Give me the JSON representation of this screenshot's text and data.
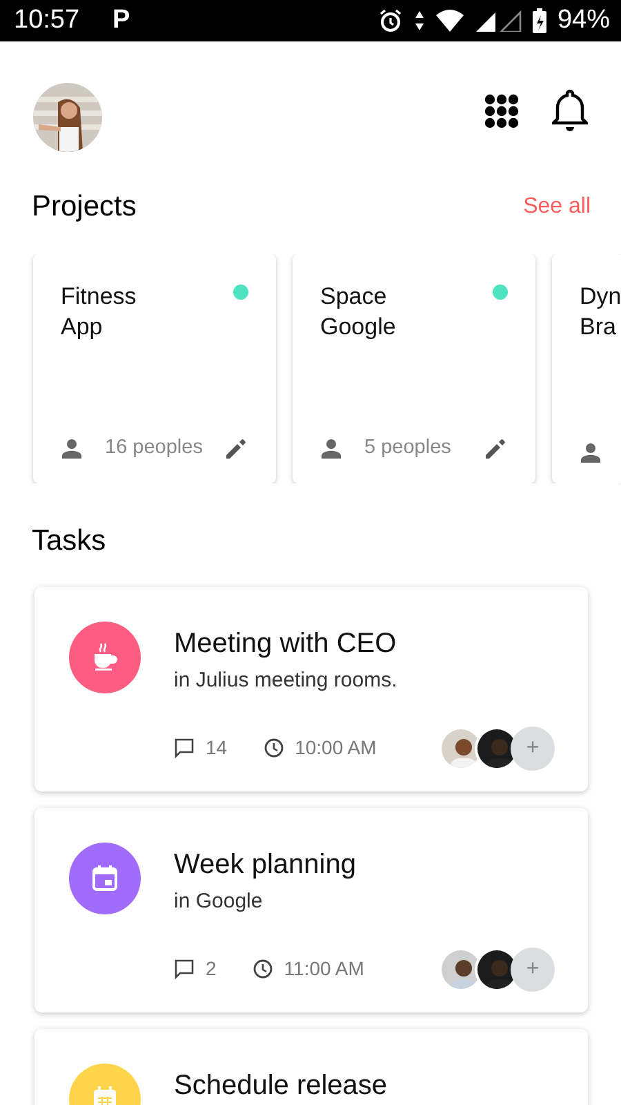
{
  "status_bar": {
    "time": "10:57",
    "notification": "P",
    "battery": "94%"
  },
  "projects": {
    "title": "Projects",
    "link": "See all",
    "items": [
      {
        "title": "Fitness\nApp",
        "people": "16 peoples",
        "color": "#4fe3c1"
      },
      {
        "title": "Space\nGoogle",
        "people": "5 peoples",
        "color": "#4fe3c1"
      },
      {
        "title": "Dyn\nBra"
      }
    ]
  },
  "tasks": {
    "title": "Tasks",
    "items": [
      {
        "kind": "coffee",
        "color": "#fe5c83",
        "title": "Meeting with CEO",
        "place": "in Julius meeting rooms.",
        "comments": "14",
        "time": "10:00 AM",
        "add": "+"
      },
      {
        "kind": "calendar",
        "color": "#a16cfb",
        "title": "Week planning",
        "place": "in Google",
        "comments": "2",
        "time": "11:00 AM",
        "add": "+"
      },
      {
        "kind": "schedule",
        "color": "#fed54a",
        "title": "Schedule release"
      }
    ]
  }
}
